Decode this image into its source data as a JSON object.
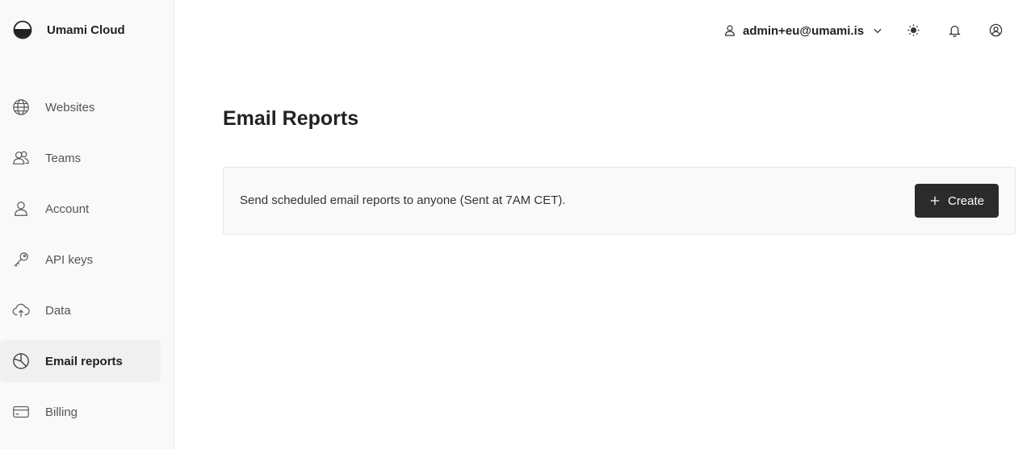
{
  "brand": {
    "name": "Umami Cloud"
  },
  "sidebar": {
    "items": [
      {
        "label": "Websites",
        "icon": "globe-icon",
        "active": false
      },
      {
        "label": "Teams",
        "icon": "users-icon",
        "active": false
      },
      {
        "label": "Account",
        "icon": "user-icon",
        "active": false
      },
      {
        "label": "API keys",
        "icon": "key-icon",
        "active": false
      },
      {
        "label": "Data",
        "icon": "cloud-upload-icon",
        "active": false
      },
      {
        "label": "Email reports",
        "icon": "pie-chart-icon",
        "active": true
      },
      {
        "label": "Billing",
        "icon": "credit-card-icon",
        "active": false
      }
    ]
  },
  "header": {
    "user_email": "admin+eu@umami.is",
    "icons": [
      "user-icon",
      "chevron-down-icon",
      "sun-icon",
      "bell-icon",
      "user-circle-icon"
    ]
  },
  "main": {
    "title": "Email Reports",
    "panel_text": "Send scheduled email reports to anyone (Sent at 7AM CET).",
    "create_label": "Create"
  },
  "colors": {
    "sidebar_bg": "#f9f9f9",
    "active_bg": "#f0f0f0",
    "button_bg": "#2b2b2b",
    "text": "#222222"
  }
}
